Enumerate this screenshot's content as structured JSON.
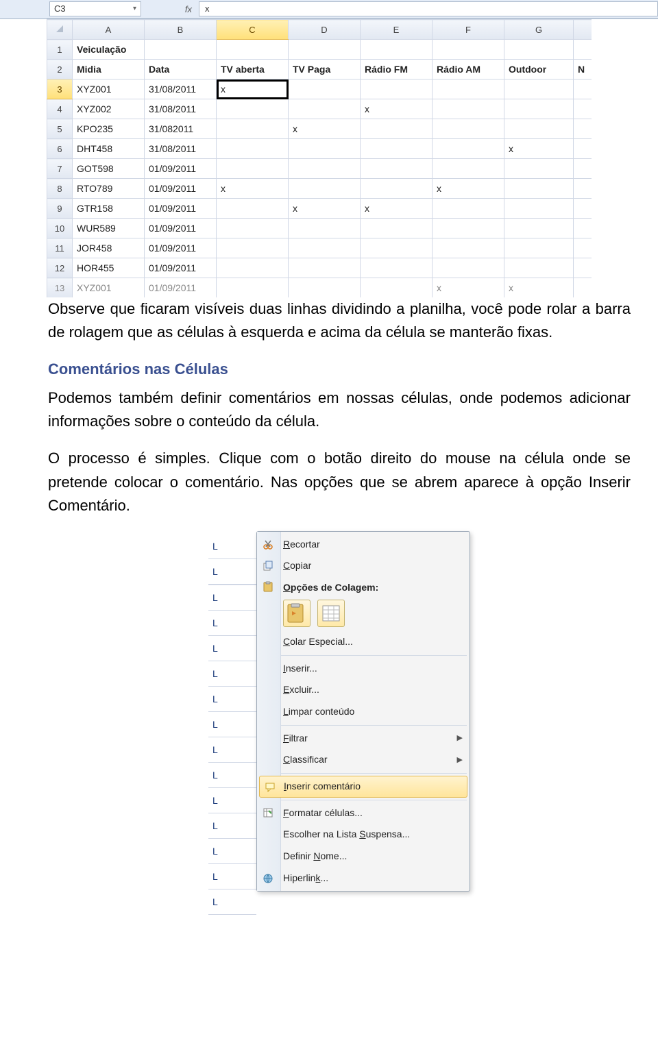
{
  "formula_bar": {
    "name_box": "C3",
    "fx_label": "fx",
    "formula_value": "x"
  },
  "grid": {
    "columns": [
      "A",
      "B",
      "C",
      "D",
      "E",
      "F",
      "G",
      ""
    ],
    "active_column": "C",
    "active_row": 3,
    "rows": [
      {
        "n": 1,
        "cells": [
          "Veiculação",
          "",
          "",
          "",
          "",
          "",
          "",
          ""
        ],
        "bold": [
          0
        ]
      },
      {
        "n": 2,
        "cells": [
          "Midia",
          "Data",
          "TV aberta",
          "TV Paga",
          "Rádio FM",
          "Rádio AM",
          "Outdoor",
          "N"
        ],
        "bold": [
          0,
          1,
          2,
          3,
          4,
          5,
          6,
          7
        ]
      },
      {
        "n": 3,
        "cells": [
          "XYZ001",
          "31/08/2011",
          "x",
          "",
          "",
          "",
          "",
          ""
        ],
        "selected": 2
      },
      {
        "n": 4,
        "cells": [
          "XYZ002",
          "31/08/2011",
          "",
          "",
          "x",
          "",
          "",
          ""
        ]
      },
      {
        "n": 5,
        "cells": [
          "KPO235",
          "31/082011",
          "",
          "x",
          "",
          "",
          "",
          ""
        ]
      },
      {
        "n": 6,
        "cells": [
          "DHT458",
          "31/08/2011",
          "",
          "",
          "",
          "",
          "x",
          ""
        ]
      },
      {
        "n": 7,
        "cells": [
          "GOT598",
          "01/09/2011",
          "",
          "",
          "",
          "",
          "",
          ""
        ]
      },
      {
        "n": 8,
        "cells": [
          "RTO789",
          "01/09/2011",
          "x",
          "",
          "",
          "x",
          "",
          ""
        ]
      },
      {
        "n": 9,
        "cells": [
          "GTR158",
          "01/09/2011",
          "",
          "x",
          "x",
          "",
          "",
          ""
        ]
      },
      {
        "n": 10,
        "cells": [
          "WUR589",
          "01/09/2011",
          "",
          "",
          "",
          "",
          "",
          ""
        ]
      },
      {
        "n": 11,
        "cells": [
          "JOR458",
          "01/09/2011",
          "",
          "",
          "",
          "",
          "",
          ""
        ]
      },
      {
        "n": 12,
        "cells": [
          "HOR455",
          "01/09/2011",
          "",
          "",
          "",
          "",
          "",
          ""
        ]
      },
      {
        "n": 13,
        "cells": [
          "XYZ001",
          "01/09/2011",
          "",
          "",
          "",
          "x",
          "x",
          ""
        ],
        "partial": true
      }
    ]
  },
  "doc": {
    "p1": "Observe que ficaram visíveis duas linhas dividindo a planilha, você pode rolar a barra de rolagem que as células à esquerda e acima da célula se manterão fixas.",
    "h1": "Comentários nas Células",
    "p2": "Podemos também definir comentários em nossas células, onde podemos adicionar informações sobre o conteúdo da célula.",
    "p3": "O processo é simples. Clique com o botão direito do mouse na célula onde se pretende colocar o comentário. Nas opções que se abrem aparece à opção Inserir Comentário."
  },
  "context_menu": {
    "left_labels": [
      "L",
      "L",
      "",
      "L",
      "L",
      "L",
      "L",
      "L",
      "L",
      "L",
      "L",
      "L",
      "L",
      "L",
      "L",
      "L"
    ],
    "items": [
      {
        "kind": "item",
        "label": "Recortar",
        "icon": "cut"
      },
      {
        "kind": "item",
        "label": "Copiar",
        "icon": "copy"
      },
      {
        "kind": "head",
        "label": "Opções de Colagem:",
        "icon": "paste"
      },
      {
        "kind": "bigicons"
      },
      {
        "kind": "item",
        "label": "Colar Especial..."
      },
      {
        "kind": "sep"
      },
      {
        "kind": "item",
        "label": "Inserir..."
      },
      {
        "kind": "item",
        "label": "Excluir..."
      },
      {
        "kind": "item",
        "label": "Limpar conteúdo"
      },
      {
        "kind": "sep"
      },
      {
        "kind": "item",
        "label": "Filtrar",
        "arrow": true
      },
      {
        "kind": "item",
        "label": "Classificar",
        "arrow": true
      },
      {
        "kind": "sep"
      },
      {
        "kind": "item",
        "label": "Inserir comentário",
        "icon": "comment",
        "hover": true
      },
      {
        "kind": "sep"
      },
      {
        "kind": "item",
        "label": "Formatar células...",
        "icon": "format"
      },
      {
        "kind": "item",
        "label": "Escolher na Lista Suspensa..."
      },
      {
        "kind": "item",
        "label": "Definir Nome..."
      },
      {
        "kind": "item",
        "label": "Hiperlink...",
        "icon": "hyperlink"
      }
    ]
  }
}
